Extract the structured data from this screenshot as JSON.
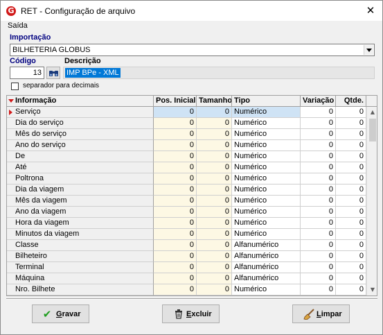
{
  "window": {
    "title": "RET - Configuração de arquivo",
    "close_glyph": "✕",
    "app_icon_letter": "G"
  },
  "menu": {
    "saida": "Saída"
  },
  "importacao": {
    "label": "Importação",
    "value": "BILHETERIA GLOBUS"
  },
  "codigo": {
    "label": "Código",
    "value": "13"
  },
  "descricao": {
    "label": "Descrição",
    "value": "IMP BPe - XML"
  },
  "separador": {
    "label": "separador para decimais",
    "checked": false
  },
  "grid": {
    "headers": {
      "informacao": "Informação",
      "pos_inicial": "Pos. Inicial",
      "tamanho": "Tamanho",
      "tipo": "Tipo",
      "variacao": "Variação",
      "qtde": "Qtde."
    },
    "rows": [
      {
        "informacao": "Serviço",
        "pos_inicial": "0",
        "tamanho": "0",
        "tipo": "Numérico",
        "variacao": "0",
        "qtde": "0",
        "selected": true
      },
      {
        "informacao": "Dia do serviço",
        "pos_inicial": "0",
        "tamanho": "0",
        "tipo": "Numérico",
        "variacao": "0",
        "qtde": "0"
      },
      {
        "informacao": "Mês do serviço",
        "pos_inicial": "0",
        "tamanho": "0",
        "tipo": "Numérico",
        "variacao": "0",
        "qtde": "0"
      },
      {
        "informacao": "Ano do serviço",
        "pos_inicial": "0",
        "tamanho": "0",
        "tipo": "Numérico",
        "variacao": "0",
        "qtde": "0"
      },
      {
        "informacao": "De",
        "pos_inicial": "0",
        "tamanho": "0",
        "tipo": "Numérico",
        "variacao": "0",
        "qtde": "0"
      },
      {
        "informacao": "Até",
        "pos_inicial": "0",
        "tamanho": "0",
        "tipo": "Numérico",
        "variacao": "0",
        "qtde": "0"
      },
      {
        "informacao": "Poltrona",
        "pos_inicial": "0",
        "tamanho": "0",
        "tipo": "Numérico",
        "variacao": "0",
        "qtde": "0"
      },
      {
        "informacao": "Dia da viagem",
        "pos_inicial": "0",
        "tamanho": "0",
        "tipo": "Numérico",
        "variacao": "0",
        "qtde": "0"
      },
      {
        "informacao": "Mês da viagem",
        "pos_inicial": "0",
        "tamanho": "0",
        "tipo": "Numérico",
        "variacao": "0",
        "qtde": "0"
      },
      {
        "informacao": "Ano da viagem",
        "pos_inicial": "0",
        "tamanho": "0",
        "tipo": "Numérico",
        "variacao": "0",
        "qtde": "0"
      },
      {
        "informacao": "Hora da viagem",
        "pos_inicial": "0",
        "tamanho": "0",
        "tipo": "Numérico",
        "variacao": "0",
        "qtde": "0"
      },
      {
        "informacao": "Minutos da viagem",
        "pos_inicial": "0",
        "tamanho": "0",
        "tipo": "Numérico",
        "variacao": "0",
        "qtde": "0"
      },
      {
        "informacao": "Classe",
        "pos_inicial": "0",
        "tamanho": "0",
        "tipo": "Alfanumérico",
        "variacao": "0",
        "qtde": "0"
      },
      {
        "informacao": "Bilheteiro",
        "pos_inicial": "0",
        "tamanho": "0",
        "tipo": "Alfanumérico",
        "variacao": "0",
        "qtde": "0"
      },
      {
        "informacao": "Terminal",
        "pos_inicial": "0",
        "tamanho": "0",
        "tipo": "Alfanumérico",
        "variacao": "0",
        "qtde": "0"
      },
      {
        "informacao": "Máquina",
        "pos_inicial": "0",
        "tamanho": "0",
        "tipo": "Alfanumérico",
        "variacao": "0",
        "qtde": "0"
      },
      {
        "informacao": "Nro. Bilhete",
        "pos_inicial": "0",
        "tamanho": "0",
        "tipo": "Numérico",
        "variacao": "0",
        "qtde": "0"
      }
    ]
  },
  "buttons": {
    "gravar": {
      "label": "Gravar",
      "icon": "checkmark-icon"
    },
    "excluir": {
      "label": "Excluir",
      "icon": "trash-icon"
    },
    "limpar": {
      "label": "Limpar",
      "icon": "broom-icon"
    }
  },
  "colors": {
    "label_blue": "#000080",
    "accent_red": "#d11a1a",
    "selection_blue": "#0078d7",
    "checkmark_green": "#1f9d1f"
  }
}
